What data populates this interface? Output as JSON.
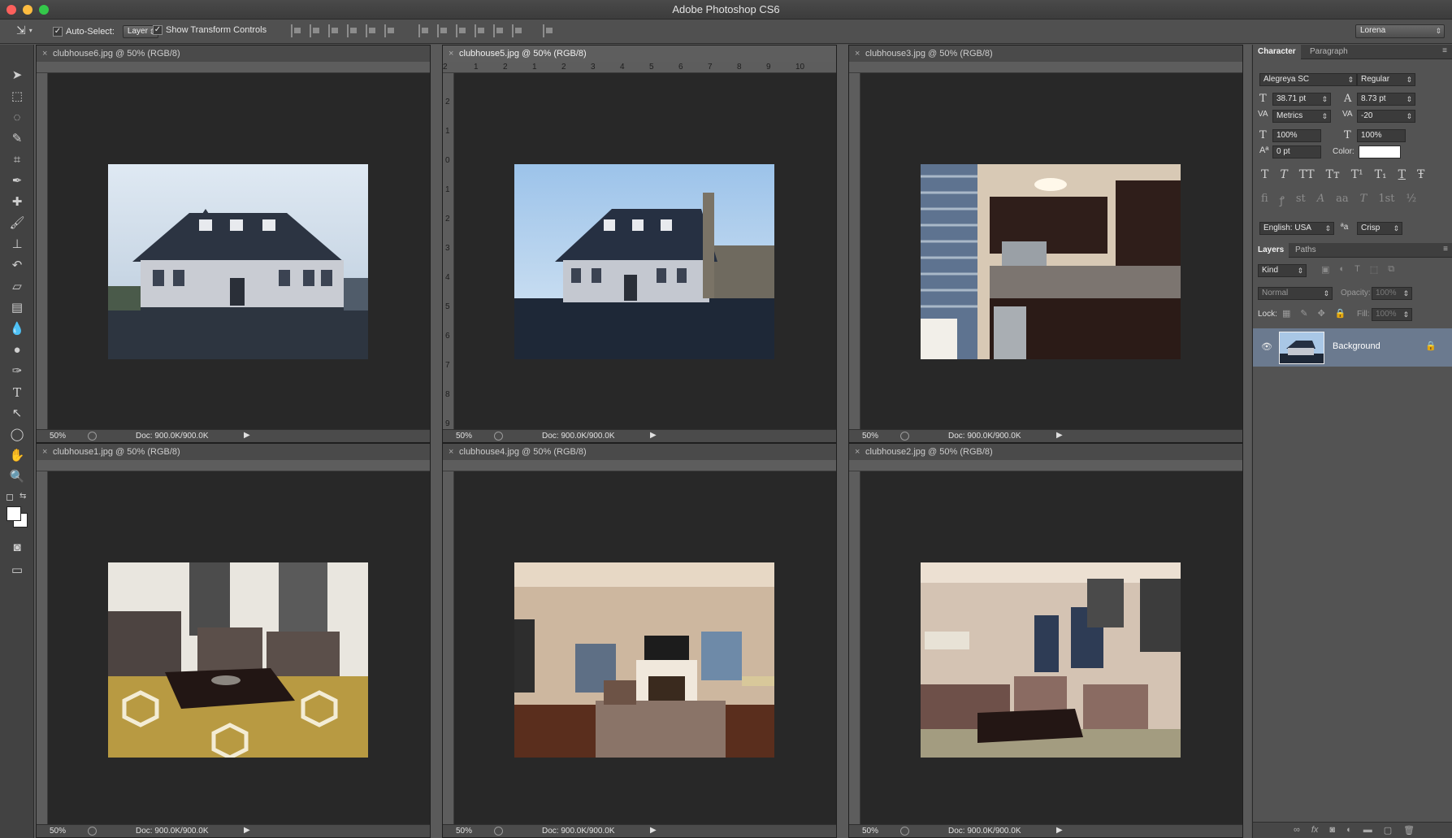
{
  "app": {
    "title": "Adobe Photoshop CS6",
    "workspace": "Lorena"
  },
  "options_bar": {
    "auto_select_label": "Auto-Select:",
    "auto_select_value": "Layer",
    "show_transform_label": "Show Transform Controls"
  },
  "documents": [
    {
      "tab": "clubhouse6.jpg @ 50% (RGB/8)",
      "zoom": "50%",
      "doc_info": "Doc: 900.0K/900.0K",
      "active": false,
      "scene": "exterior"
    },
    {
      "tab": "clubhouse5.jpg @ 50% (RGB/8)",
      "zoom": "50%",
      "doc_info": "Doc: 900.0K/900.0K",
      "active": true,
      "scene": "exterior2"
    },
    {
      "tab": "clubhouse3.jpg @ 50% (RGB/8)",
      "zoom": "50%",
      "doc_info": "Doc: 900.0K/900.0K",
      "active": false,
      "scene": "kitchen"
    },
    {
      "tab": "clubhouse1.jpg @ 50% (RGB/8)",
      "zoom": "50%",
      "doc_info": "Doc: 900.0K/900.0K",
      "active": false,
      "scene": "lounge"
    },
    {
      "tab": "clubhouse4.jpg @ 50% (RGB/8)",
      "zoom": "50%",
      "doc_info": "Doc: 900.0K/900.0K",
      "active": false,
      "scene": "livingroom"
    },
    {
      "tab": "clubhouse2.jpg @ 50% (RGB/8)",
      "zoom": "50%",
      "doc_info": "Doc: 900.0K/900.0K",
      "active": false,
      "scene": "lounge2"
    }
  ],
  "ruler_numbers": [
    "2",
    "1",
    "2",
    "1",
    "0",
    "1",
    "2",
    "3",
    "4",
    "5",
    "6",
    "7",
    "8",
    "9",
    "10"
  ],
  "vruler_numbers": [
    "2",
    "1",
    "0",
    "1",
    "2",
    "3",
    "4",
    "5",
    "6",
    "7",
    "8",
    "9"
  ],
  "character": {
    "tab_character": "Character",
    "tab_paragraph": "Paragraph",
    "font_family": "Alegreya SC",
    "font_style": "Regular",
    "size": "38.71 pt",
    "leading": "8.73 pt",
    "kerning": "Metrics",
    "tracking": "-20",
    "vscale": "100%",
    "hscale": "100%",
    "baseline": "0 pt",
    "color_label": "Color:",
    "language": "English: USA",
    "aa_symbol": "ªa",
    "antialias": "Crisp",
    "glyphs_row1": [
      "T",
      "T",
      "TT",
      "Tт",
      "T¹",
      "T₁",
      "T",
      "Ŧ"
    ],
    "glyphs_row2": [
      "fi",
      "ꝭ",
      "st",
      "A",
      "aa",
      "T",
      "1st",
      "½"
    ]
  },
  "layers": {
    "tab_layers": "Layers",
    "tab_paths": "Paths",
    "kind": "Kind",
    "blend_mode": "Normal",
    "opacity_label": "Opacity:",
    "opacity": "100%",
    "lock_label": "Lock:",
    "fill_label": "Fill:",
    "fill": "100%",
    "layer_name": "Background"
  },
  "colors": {
    "accent": "#6b7a8f",
    "canvas": "#282828",
    "chrome": "#535353"
  }
}
